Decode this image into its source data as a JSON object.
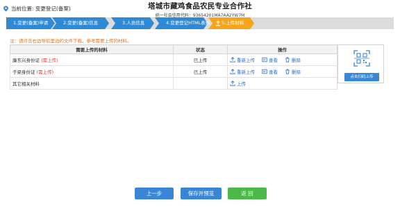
{
  "location": {
    "label": "当前位置: 变更登记(备案)"
  },
  "company": {
    "name": "塔城市藏鸡食品农民专业合作社",
    "credit": "统一社会信用代码：93654201MA7AA2YW7M"
  },
  "steps": [
    {
      "label": "1.变更(备案)申请"
    },
    {
      "label": "2.变更(备案)信息"
    },
    {
      "label": "3.人员信息"
    },
    {
      "label": "4.变更登记HTML表格"
    },
    {
      "label": "5.上传材料"
    }
  ],
  "note": "注：请点击右边导航里边的文件下载，参考需要上传的材料。",
  "table": {
    "headers": [
      "需要上传的材料",
      "状态",
      "操作"
    ],
    "rows": [
      {
        "material": "廉东兴身份证",
        "required": "(需上传)",
        "status": "已上传",
        "reupload": "重新上传",
        "view": "查看",
        "delete": "删除"
      },
      {
        "material": "于梁身份证",
        "required": "(需上传)",
        "status": "已上传",
        "reupload": "重新上传",
        "view": "查看",
        "delete": "删除"
      },
      {
        "material": "其它相关材料",
        "required": "",
        "status": "",
        "upload": "上传"
      }
    ]
  },
  "qr": {
    "button_label": "点击扫码上传"
  },
  "buttons": {
    "prev": "上一步",
    "save": "保存并预览",
    "back": "返 回"
  },
  "colors": {
    "step_active": "#2f8ad6",
    "step_current": "#f6a41a",
    "step_pending": "#dcdcdc",
    "primary": "#3a86d6",
    "success": "#4cb848",
    "note": "#e8741b",
    "required": "#e23b3b",
    "link": "#2a6fc9"
  }
}
